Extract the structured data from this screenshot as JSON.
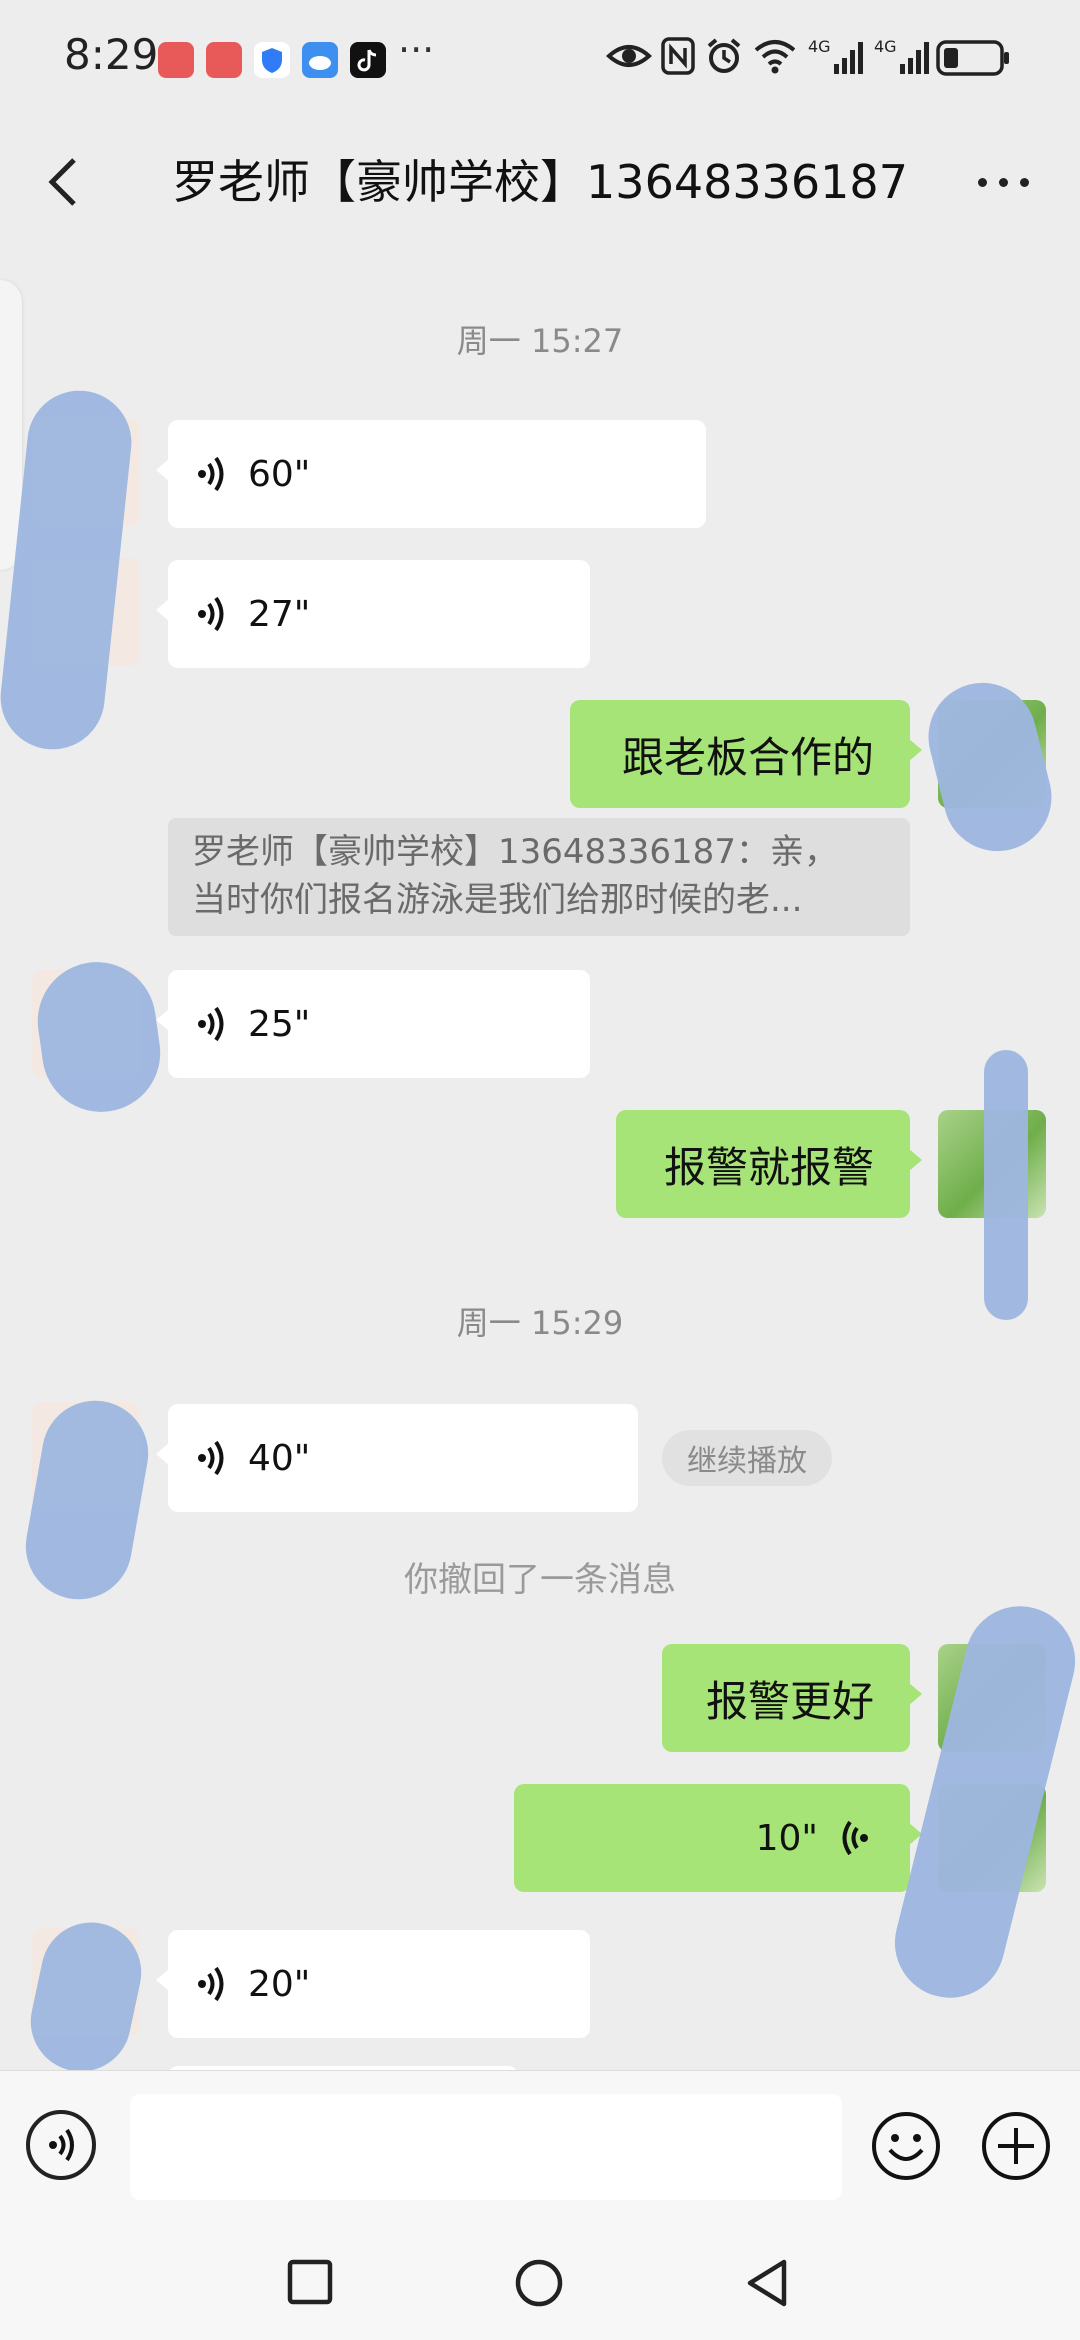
{
  "status_bar": {
    "time": "8:29",
    "more_indicator": "···",
    "network_1": "4G",
    "network_2": "4G",
    "icons": [
      "notification-app-icon",
      "notification-app-icon",
      "shield-app-icon",
      "cloud-app-icon",
      "tiktok-icon",
      "eye-icon",
      "nfc-icon",
      "alarm-icon",
      "wifi-icon",
      "signal-icon",
      "signal-icon",
      "battery-icon"
    ]
  },
  "header": {
    "title": "罗老师【豪帅学校】13648336187"
  },
  "chat": {
    "time_1": "周一 15:27",
    "time_2": "周一 15:29",
    "messages": [
      {
        "id": "m1",
        "dir": "in",
        "type": "voice",
        "duration": "60\""
      },
      {
        "id": "m2",
        "dir": "in",
        "type": "voice",
        "duration": "27\""
      },
      {
        "id": "m3",
        "dir": "out",
        "type": "text",
        "text": "跟老板合作的"
      },
      {
        "id": "m4",
        "dir": "in",
        "type": "voice",
        "duration": "25\""
      },
      {
        "id": "m5",
        "dir": "out",
        "type": "text",
        "text": "报警就报警"
      },
      {
        "id": "m6",
        "dir": "in",
        "type": "voice",
        "duration": "40\""
      },
      {
        "id": "m7",
        "dir": "out",
        "type": "text",
        "text": "报警更好"
      },
      {
        "id": "m8",
        "dir": "out",
        "type": "voice",
        "duration": "10\""
      },
      {
        "id": "m9",
        "dir": "in",
        "type": "voice",
        "duration": "20\""
      }
    ],
    "quote_line_1": "罗老师【豪帅学校】13648336187：亲，",
    "quote_line_2": "当时你们报名游泳是我们给那时候的老...",
    "continue_play": "继续播放",
    "recall_notice": "你撤回了一条消息"
  },
  "input": {
    "placeholder": ""
  },
  "colors": {
    "background": "#ededed",
    "outgoing_bubble": "#a6e477",
    "incoming_bubble": "#ffffff"
  }
}
